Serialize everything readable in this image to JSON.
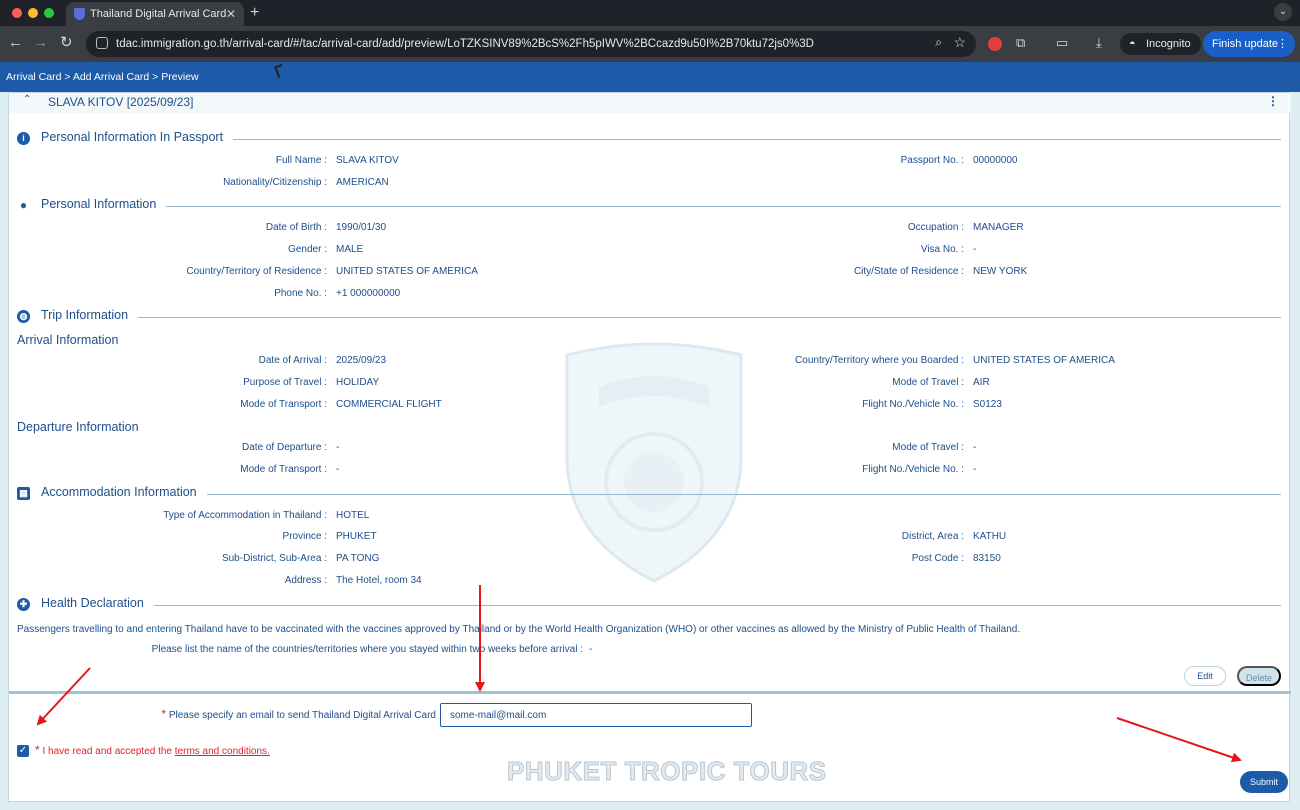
{
  "browser": {
    "tab_title": "Thailand Digital Arrival Card",
    "url": "tdac.immigration.go.th/arrival-card/#/tac/arrival-card/add/preview/LoTZKSINV89%2BcS%2Fh5pIWV%2BCcazd9u50I%2B70ktu72js0%3D",
    "incognito_label": "Incognito",
    "update_label": "Finish update"
  },
  "page": {
    "breadcrumb": "Arrival Card > Add Arrival Card > Preview",
    "passenger_header": "SLAVA KITOV [2025/09/23]",
    "watermark": "PHUKET TROPIC TOURS"
  },
  "sections": {
    "passport": {
      "title": "Personal Information In Passport",
      "full_name_label": "Full Name :",
      "full_name": "SLAVA KITOV",
      "passport_no_label": "Passport No. :",
      "passport_no": "00000000",
      "nationality_label": "Nationality/Citizenship :",
      "nationality": "AMERICAN"
    },
    "personal": {
      "title": "Personal Information",
      "dob_label": "Date of Birth :",
      "dob": "1990/01/30",
      "occupation_label": "Occupation :",
      "occupation": "MANAGER",
      "gender_label": "Gender :",
      "gender": "MALE",
      "visa_label": "Visa No. :",
      "visa": "-",
      "residence_country_label": "Country/Territory of Residence :",
      "residence_country": "UNITED STATES OF AMERICA",
      "residence_city_label": "City/State of Residence :",
      "residence_city": "NEW YORK",
      "phone_label": "Phone No. :",
      "phone": "+1 000000000"
    },
    "trip": {
      "title": "Trip Information",
      "arrival_heading": "Arrival Information",
      "arrival_date_label": "Date of Arrival :",
      "arrival_date": "2025/09/23",
      "boarded_label": "Country/Territory where you Boarded :",
      "boarded": "UNITED STATES OF AMERICA",
      "purpose_label": "Purpose of Travel :",
      "purpose": "HOLIDAY",
      "arr_mode_travel_label": "Mode of Travel :",
      "arr_mode_travel": "AIR",
      "arr_mode_transport_label": "Mode of Transport :",
      "arr_mode_transport": "COMMERCIAL FLIGHT",
      "arr_flight_label": "Flight No./Vehicle No. :",
      "arr_flight": "S0123",
      "departure_heading": "Departure Information",
      "dep_date_label": "Date of Departure :",
      "dep_date": "-",
      "dep_mode_travel_label": "Mode of Travel :",
      "dep_mode_travel": "-",
      "dep_mode_transport_label": "Mode of Transport :",
      "dep_mode_transport": "-",
      "dep_flight_label": "Flight No./Vehicle No. :",
      "dep_flight": "-"
    },
    "accommodation": {
      "title": "Accommodation Information",
      "type_label": "Type of Accommodation in Thailand :",
      "type": "HOTEL",
      "province_label": "Province :",
      "province": "PHUKET",
      "district_label": "District, Area :",
      "district": "KATHU",
      "subdistrict_label": "Sub-District, Sub-Area :",
      "subdistrict": "PA TONG",
      "postcode_label": "Post Code :",
      "postcode": "83150",
      "address_label": "Address :",
      "address": "The Hotel, room 34"
    },
    "health": {
      "title": "Health Declaration",
      "notice": "Passengers travelling to and entering Thailand have to be vaccinated with the vaccines approved by Thailand or by the World Health Organization (WHO) or other vaccines as allowed by the Ministry of Public Health of Thailand.",
      "countries_label": "Please list the name of the countries/territories where you stayed within two weeks before arrival :",
      "countries": "-"
    }
  },
  "actions": {
    "edit_label": "Edit",
    "delete_label": "Delete",
    "email_label": "Please specify an email to send Thailand Digital Arrival Card",
    "email_value": "some-mail@mail.com",
    "required_mark": "*",
    "terms_prefix": "I have read and accepted the",
    "terms_link": "terms and conditions.",
    "terms_checked": true,
    "submit_label": "Submit"
  },
  "colors": {
    "brand": "#1d5aa7",
    "text": "#1d4f8a",
    "required": "#e0212b",
    "annotation_arrow": "#e8141c"
  },
  "icons": {
    "passport": "info-icon",
    "personal": "person-icon",
    "trip": "globe-icon",
    "accommodation": "building-icon",
    "health": "shield-icon"
  }
}
